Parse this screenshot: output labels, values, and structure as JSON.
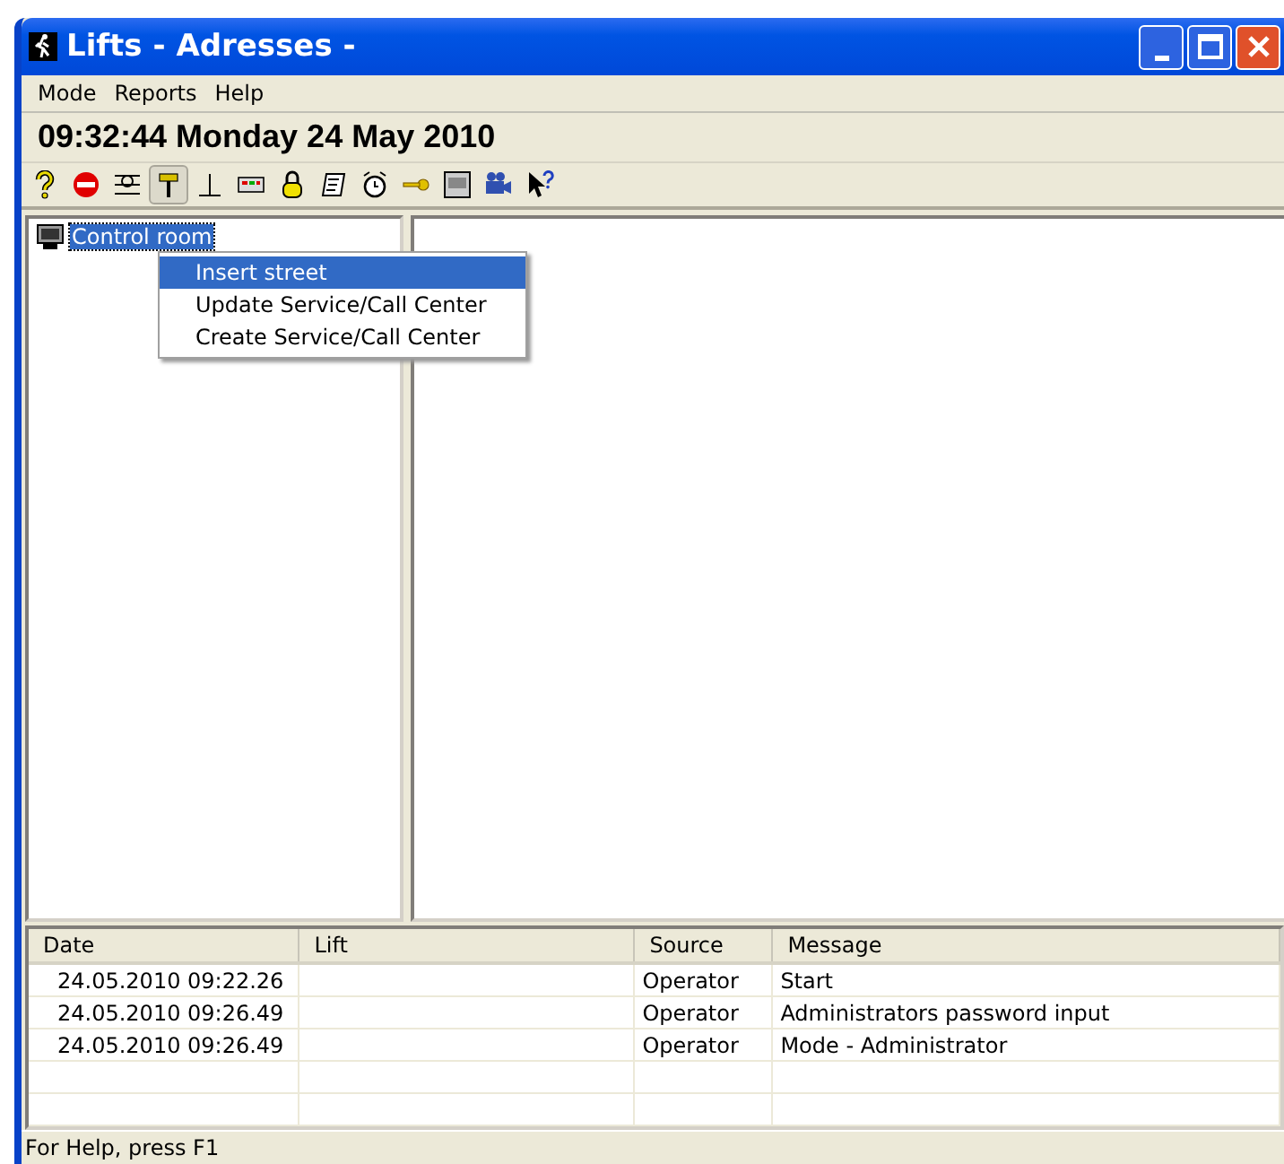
{
  "window": {
    "title": "Lifts - Adresses -"
  },
  "menu": [
    "Mode",
    "Reports",
    "Help"
  ],
  "clock": "09:32:44 Monday 24 May 2010",
  "toolbar": [
    {
      "kind": "help",
      "pressed": false
    },
    {
      "kind": "stop",
      "pressed": false
    },
    {
      "kind": "lines",
      "pressed": false
    },
    {
      "kind": "hammer",
      "pressed": true
    },
    {
      "kind": "perp",
      "pressed": false
    },
    {
      "kind": "display",
      "pressed": false
    },
    {
      "kind": "lock",
      "pressed": false
    },
    {
      "kind": "scroll",
      "pressed": false
    },
    {
      "kind": "clock",
      "pressed": false
    },
    {
      "kind": "key",
      "pressed": false
    },
    {
      "kind": "monitor",
      "pressed": false
    },
    {
      "kind": "camera",
      "pressed": false
    },
    {
      "kind": "pointer",
      "pressed": false
    }
  ],
  "tree": [
    {
      "label": "Control room",
      "selected": true
    }
  ],
  "context_menu": [
    {
      "label": "Insert street",
      "selected": true
    },
    {
      "label": "Update Service/Call Center",
      "selected": false
    },
    {
      "label": "Create Service/Call Center",
      "selected": false
    }
  ],
  "log": {
    "columns": [
      "Date",
      "Lift",
      "Source",
      "Message"
    ],
    "rows": [
      [
        "24.05.2010 09:22.26",
        "",
        "Operator",
        "Start"
      ],
      [
        "24.05.2010 09:26.49",
        "",
        "Operator",
        "Administrators password input"
      ],
      [
        "24.05.2010 09:26.49",
        "",
        "Operator",
        "Mode - Administrator"
      ]
    ]
  },
  "status_bar": "For Help, press F1"
}
